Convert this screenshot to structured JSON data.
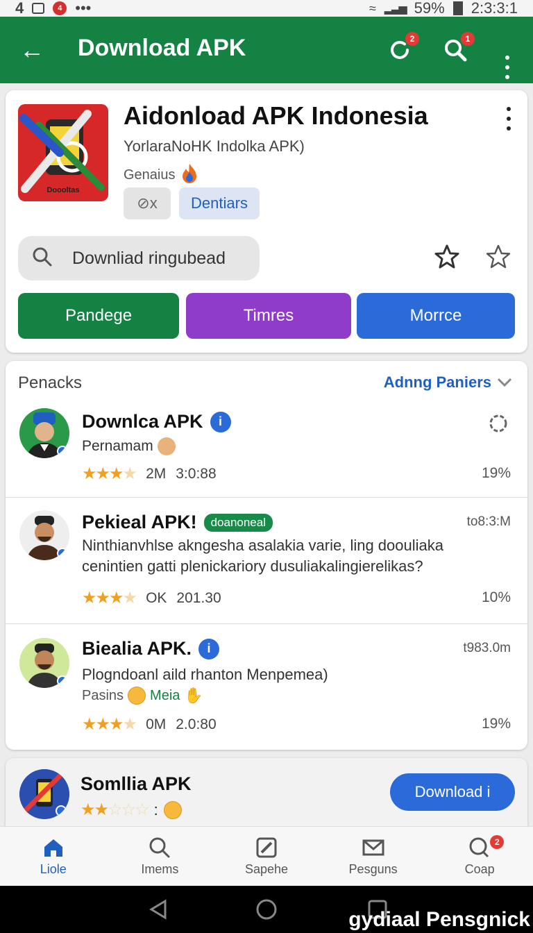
{
  "status_bar": {
    "left_text": "4",
    "badge": "4",
    "dots": "•••",
    "battery": "59%",
    "time": "2:3:3:1"
  },
  "app_bar": {
    "title": "Download APK",
    "refresh_badge": "2",
    "search_badge": "1",
    "color": "#138243"
  },
  "app_header": {
    "logo_text": "Doooltas",
    "title": "Aidonload APK Indonesia",
    "subtitle": "YorlaraNoHK Indolka APK)",
    "developer": "Genaius",
    "chip_gray": "⊘x",
    "chip_blue": "Dentiars",
    "search_placeholder": "Downliad ringubead",
    "buttons": {
      "green": "Pandege",
      "purple": "Timres",
      "blue": "Morrce"
    }
  },
  "list": {
    "title": "Penacks",
    "action": "Adnng Paniers",
    "items": [
      {
        "title": "Downlca APK",
        "subtitle": "Pernamam",
        "rating_count": "2M",
        "time": "3:0:88",
        "percent": "19%",
        "stars": 3
      },
      {
        "title": "Pekieal APK!",
        "tag": "doanoneal",
        "time_right": "to8:3:M",
        "body_line1": "Ninthianvhlse akngesha asalakia varie, ling doouliaka",
        "body_line2": "cenintien gatti plenickariory dusuliakalingierelikas?",
        "rating_count": "OK",
        "time": "201.30",
        "percent": "10%",
        "stars": 3
      },
      {
        "title": "Biealia APK.",
        "time_right": "t983.0m",
        "subtitle": "Plogndoanl aild rhanton Menpemea)",
        "sub2_a": "Pasins",
        "sub2_b": "Meia",
        "rating_count": "0M",
        "time": "2.0:80",
        "percent": "19%",
        "stars": 3
      }
    ]
  },
  "promo": {
    "title": "Somllia APK",
    "colon": ":",
    "button": "Download i"
  },
  "bottom_nav": [
    {
      "label": "Liole",
      "icon": "home-icon",
      "active": true
    },
    {
      "label": "Imems",
      "icon": "search-icon",
      "active": false
    },
    {
      "label": "Sapehe",
      "icon": "edit-icon",
      "active": false
    },
    {
      "label": "Pesguns",
      "icon": "mail-icon",
      "active": false
    },
    {
      "label": "Coap",
      "icon": "chat-icon",
      "active": false,
      "badge": "2"
    }
  ],
  "watermark": "gydiaal Pensgnick"
}
